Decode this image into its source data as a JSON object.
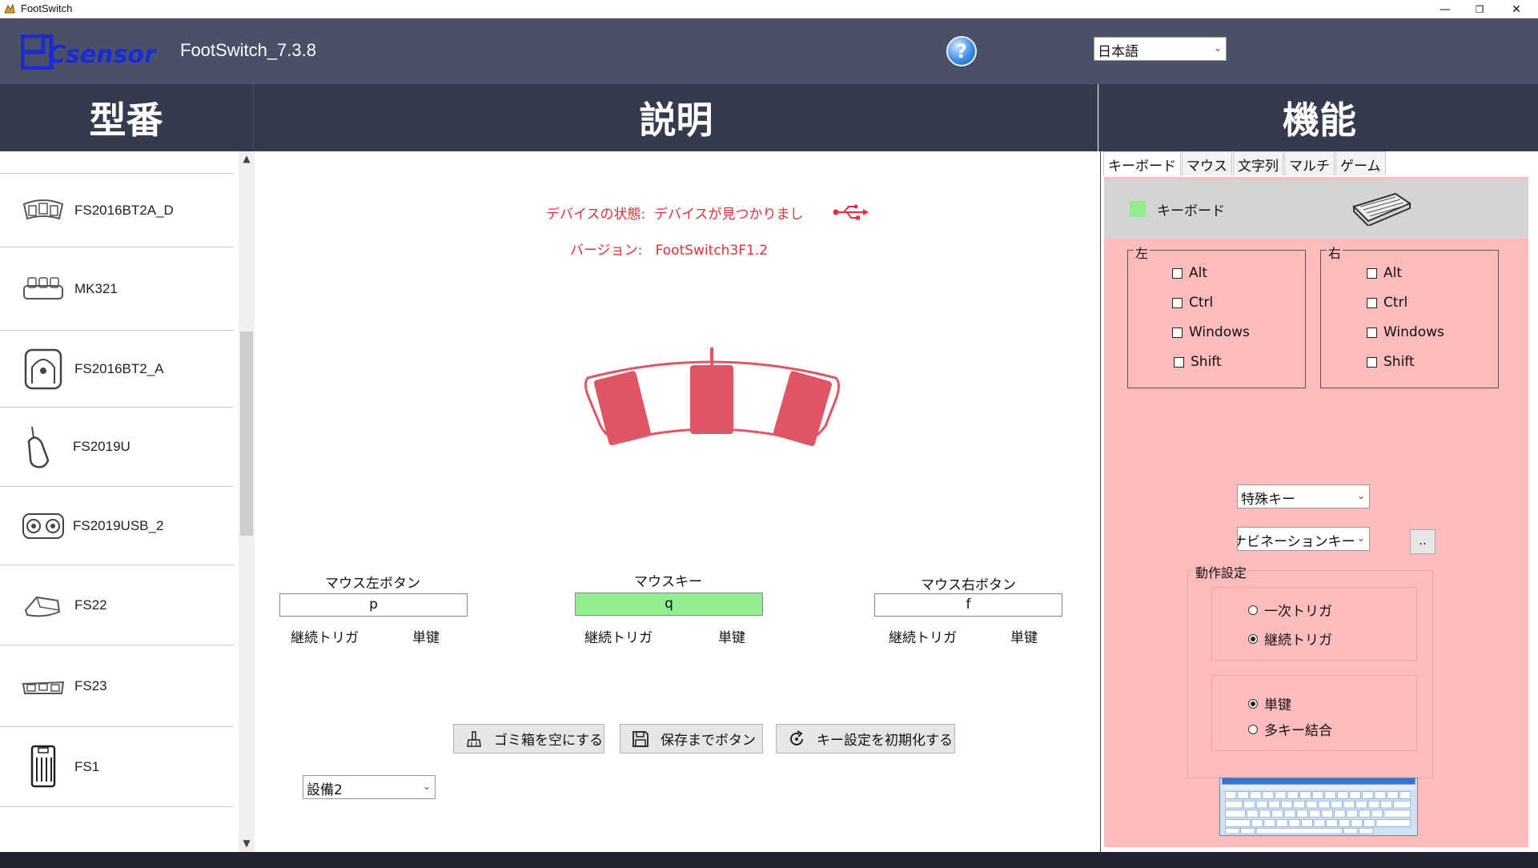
{
  "window": {
    "title": "FootSwitch",
    "controls": {
      "minimize": "—",
      "restore": "❐",
      "close": "✕"
    }
  },
  "header": {
    "logo_text": "PCsensor",
    "app_name": "FootSwitch_7.3.8",
    "help_glyph": "?",
    "language": "日本語"
  },
  "columns": {
    "model": "型番",
    "description": "説明",
    "function": "機能"
  },
  "models": [
    {
      "name": "FS2016BT2A_D",
      "icon": "triple-pedal-icon"
    },
    {
      "name": "MK321",
      "icon": "mini-keyboard-icon"
    },
    {
      "name": "FS2016BT2_A",
      "icon": "single-pedal-icon"
    },
    {
      "name": "FS2019U",
      "icon": "handheld-switch-icon"
    },
    {
      "name": "FS2019USB_2",
      "icon": "dual-pedal-icon"
    },
    {
      "name": "FS22",
      "icon": "flat-pedal-icon"
    },
    {
      "name": "FS23",
      "icon": "triple-flat-pedal-icon"
    },
    {
      "name": "FS1",
      "icon": "tall-pedal-icon"
    }
  ],
  "device": {
    "status_label": "デバイスの状態:",
    "status_value": "デバイスが見つかりまし",
    "version_label": "バージョン:",
    "version_value": "FootSwitch3F1.2"
  },
  "pedals": [
    {
      "label": "マウス左ボタン",
      "key": "p",
      "mode": "継続トリガ",
      "type": "単键"
    },
    {
      "label": "マウスキー",
      "key": "q",
      "mode": "継続トリガ",
      "type": "単键"
    },
    {
      "label": "マウス右ボタン",
      "key": "f",
      "mode": "継続トリガ",
      "type": "単键"
    }
  ],
  "actions": {
    "trash": "ゴミ箱を空にする",
    "save": "保存までボタン",
    "reset": "キー設定を初期化する"
  },
  "device_select": "設備2",
  "tabs": [
    "キーボード",
    "マウス",
    "文字列",
    "マルチ",
    "ゲーム"
  ],
  "keyboard_panel": {
    "title": "キーボード",
    "left_group": "左",
    "right_group": "右",
    "modifiers": [
      "Alt",
      "Ctrl",
      "Windows",
      "Shift"
    ],
    "special_key": "特殊キー",
    "nav_key": "ナビネーションキー",
    "more_button": "..",
    "operation_group": "動作設定",
    "trigger_options": [
      "一次トリガ",
      "継続トリガ"
    ],
    "trigger_selected": "継続トリガ",
    "key_options": [
      "単键",
      "多キー結合"
    ],
    "key_selected": "単键"
  },
  "colors": {
    "header_bg": "#4a5166",
    "colhead_bg": "#343b4d",
    "accent_red": "#e0303a",
    "pedal_red": "#e05565",
    "panel_pink": "#ffbcbc",
    "active_green": "#90ee90"
  }
}
